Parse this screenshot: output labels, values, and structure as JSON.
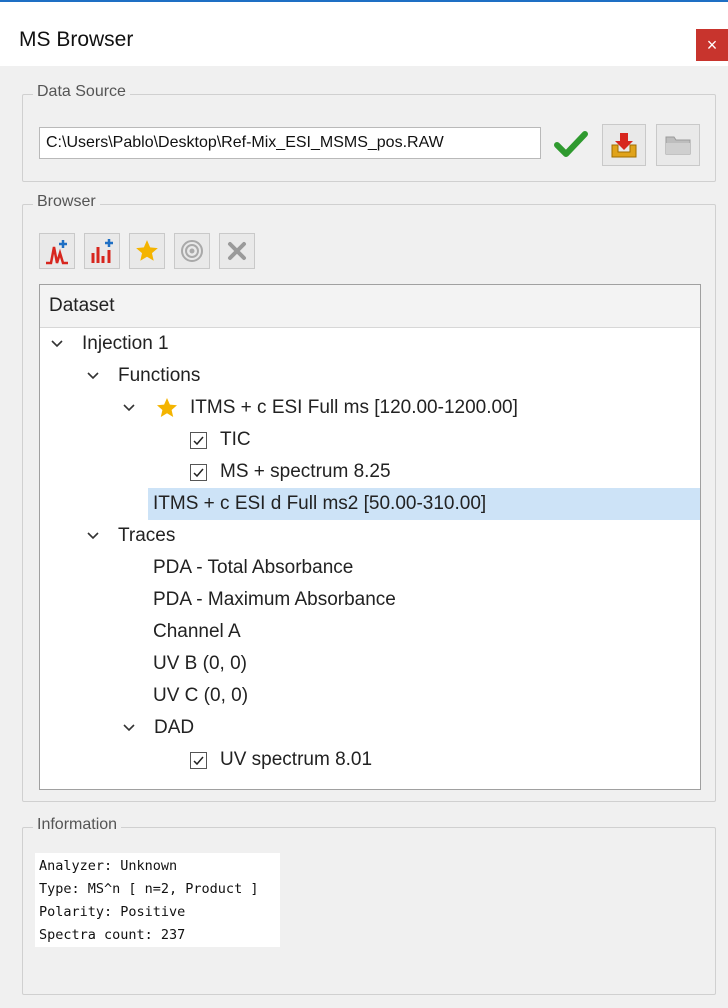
{
  "window": {
    "title": "MS Browser",
    "close_label": "×"
  },
  "data_source": {
    "group_label": "Data Source",
    "file_path": "C:\\Users\\Pablo\\Desktop\\Ref-Mix_ESI_MSMS_pos.RAW",
    "icons": [
      "check-icon",
      "download-icon",
      "folder-icon"
    ]
  },
  "browser": {
    "group_label": "Browser",
    "toolbar_icons": [
      "chromatogram-add-icon",
      "spectrum-add-icon",
      "star-icon",
      "target-icon",
      "delete-icon"
    ],
    "tree_header": "Dataset",
    "tree": {
      "injection": "Injection 1",
      "functions": "Functions",
      "function1": "ITMS + c ESI Full ms [120.00-1200.00]",
      "tic": "TIC",
      "ms_spectrum": "MS + spectrum 8.25",
      "function2": "ITMS + c ESI d Full ms2 [50.00-310.00]",
      "traces": "Traces",
      "pda_total": "PDA - Total Absorbance",
      "pda_max": "PDA - Maximum Absorbance",
      "channel_a": "Channel A",
      "uv_b": "UV B (0, 0)",
      "uv_c": "UV C (0, 0)",
      "dad": "DAD",
      "uv_spectrum": "UV spectrum 8.01"
    }
  },
  "information": {
    "group_label": "Information",
    "lines": [
      "Analyzer: Unknown",
      "Type: MS^n [ n=2, Product ]",
      "Polarity: Positive",
      "Spectra count: 237"
    ]
  },
  "colors": {
    "accent": "#1e6fc4",
    "selection": "#cde3f7",
    "close": "#c8342d",
    "check": "#2f9a2f",
    "star": "#f4b400"
  }
}
